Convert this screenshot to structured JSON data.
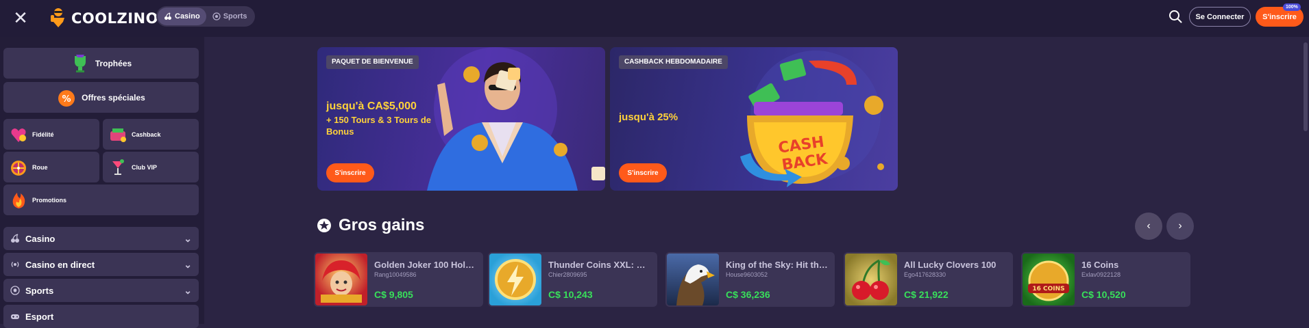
{
  "header": {
    "close_glyph": "✕",
    "logo_text": "COOLZINO",
    "modes": [
      {
        "label": "Casino",
        "icon": "cherries-icon",
        "active": true
      },
      {
        "label": "Sports",
        "icon": "soccer-ball-icon",
        "active": false
      }
    ],
    "login_label": "Se Connecter",
    "signup_label": "S'inscrire",
    "signup_badge": "100%"
  },
  "sidebar": {
    "trophies": "Trophées",
    "special_offers": "Offres spéciales",
    "grid": [
      {
        "label": "Fidélité",
        "icon": "loyalty-icon"
      },
      {
        "label": "Cashback",
        "icon": "cashback-icon"
      },
      {
        "label": "Roue",
        "icon": "wheel-icon"
      },
      {
        "label": "Club VIP",
        "icon": "cocktail-icon"
      },
      {
        "label": "Promotions",
        "icon": "fire-icon"
      }
    ],
    "accordions": [
      {
        "label": "Casino",
        "icon": "cherries-icon"
      },
      {
        "label": "Casino en direct",
        "icon": "live-icon"
      },
      {
        "label": "Sports",
        "icon": "soccer-ball-icon"
      },
      {
        "label": "Esport",
        "icon": "gamepad-icon"
      }
    ]
  },
  "banners": [
    {
      "tag": "PAQUET DE BIENVENUE",
      "headline": "jusqu'à CA$5,000",
      "subline": "+ 150 Tours & 3 Tours de Bonus",
      "cta": "S'inscrire"
    },
    {
      "tag": "CASHBACK HEBDOMADAIRE",
      "headline": "jusqu'à 25%",
      "subline": "",
      "cta": "S'inscrire",
      "art_text_1": "CASH",
      "art_text_2": "BACK"
    }
  ],
  "big_wins": {
    "title": "Gros gains",
    "prev": "‹",
    "next": "›",
    "games": [
      {
        "name": "Golden Joker 100 Hold ...",
        "user": "Rang10049586",
        "amount": "C$ 9,805"
      },
      {
        "name": "Thunder Coins XXL: Hol...",
        "user": "Chier2809695",
        "amount": "C$ 10,243"
      },
      {
        "name": "King of the Sky: Hit the ...",
        "user": "House9603052",
        "amount": "C$ 36,236"
      },
      {
        "name": "All Lucky Clovers 100",
        "user": "Ego417628330",
        "amount": "C$ 21,922"
      },
      {
        "name": "16 Coins",
        "user": "Exlav0922128",
        "amount": "C$ 10,520",
        "art_text": "16 COINS"
      }
    ]
  },
  "colors": {
    "accent": "#ff5a1a",
    "win_green": "#38e05a",
    "banner_gold": "#ffd23a",
    "background": "#2b2443"
  }
}
